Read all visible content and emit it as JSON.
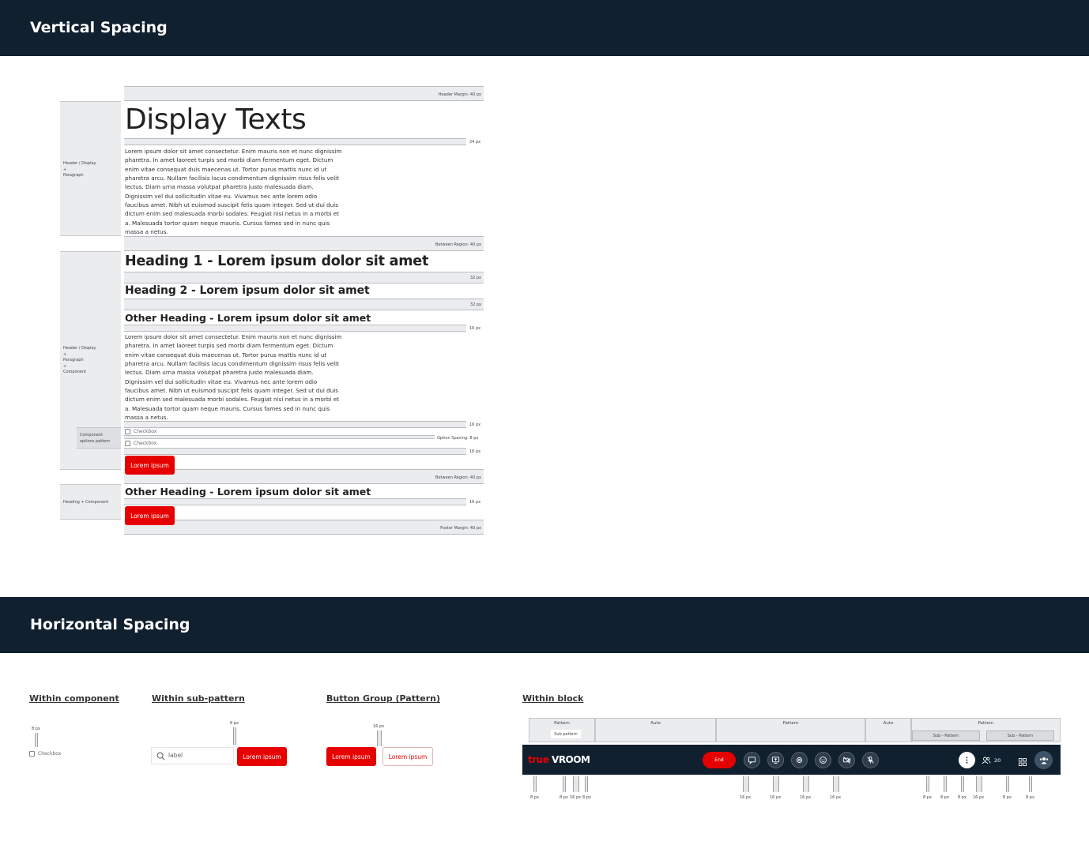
{
  "vertical": {
    "title": "Vertical Spacing",
    "display_title": "Display Texts",
    "paragraph": "Lorem ipsum dolor sit amet consectetur. Enim mauris non et nunc dignissim pharetra. In amet laoreet turpis sed morbi diam fermentum eget. Dictum enim vitae consequat duis maecenas ut. Tortor purus mattis nunc id ut pharetra arcu. Nullam facilisis lacus condimentum dignissim risus felis velit lectus. Diam urna massa volutpat pharetra justo malesuada diam. Dignissim vel dui sollicitudin vitae eu. Vivamus nec ante lorem odio faucibus amet. Nibh ut euismod suscipit felis quam integer. Sed ut dui duis dictum enim sed malesuada morbi sodales. Feugiat nisi netus in a morbi et a. Malesuada tortor quam neque mauris. Cursus fames sed in nunc quis massa a netus.",
    "heading1": "Heading 1 - Lorem ipsum dolor sit amet",
    "heading2": "Heading 2 - Lorem ipsum dolor sit amet",
    "other_heading": "Other Heading - Lorem ipsum dolor sit amet",
    "checkbox_label": "Checkbox",
    "button_label": "Lorem ipsum",
    "labels": {
      "header_margin": "Header Margin: 40 px",
      "px24": "24 px",
      "between_region": "Between Region: 40 px",
      "px32": "32 px",
      "px16": "16 px",
      "option_spacing": "Option Spacing: 8 px",
      "footer_margin": "Footer Margin: 40 px"
    },
    "side": {
      "header_display_paragraph": "Header / Display\n+\nParagraph",
      "header_display_paragraph_component": "Header / Display\n+\nParagraph\n+\nComponent",
      "component_options_pattern": "Component\noptions pattern",
      "heading_component": "Heading + Component"
    }
  },
  "horizontal": {
    "title": "Horizontal Spacing",
    "within_component": "Within component",
    "within_sub_pattern": "Within sub-pattern",
    "button_group": "Button Group (Pattern)",
    "within_block": "Within block",
    "px8": "8 px",
    "px16": "16 px",
    "checkbox_label": "Checkbox",
    "input_placeholder": "label",
    "button_label": "Lorem ipsum",
    "block_bands": {
      "pattern": "Pattern",
      "sub_pattern": "Sub pattern",
      "auto": "Auto",
      "sub_pattern_dash": "Sub - Pattern"
    },
    "toolbar": {
      "logo_true": "true",
      "logo_vroom": "VROOM",
      "end_label": "End",
      "participants_count": "20"
    },
    "accent_color": "#e60000",
    "banner_color": "#11202f"
  }
}
